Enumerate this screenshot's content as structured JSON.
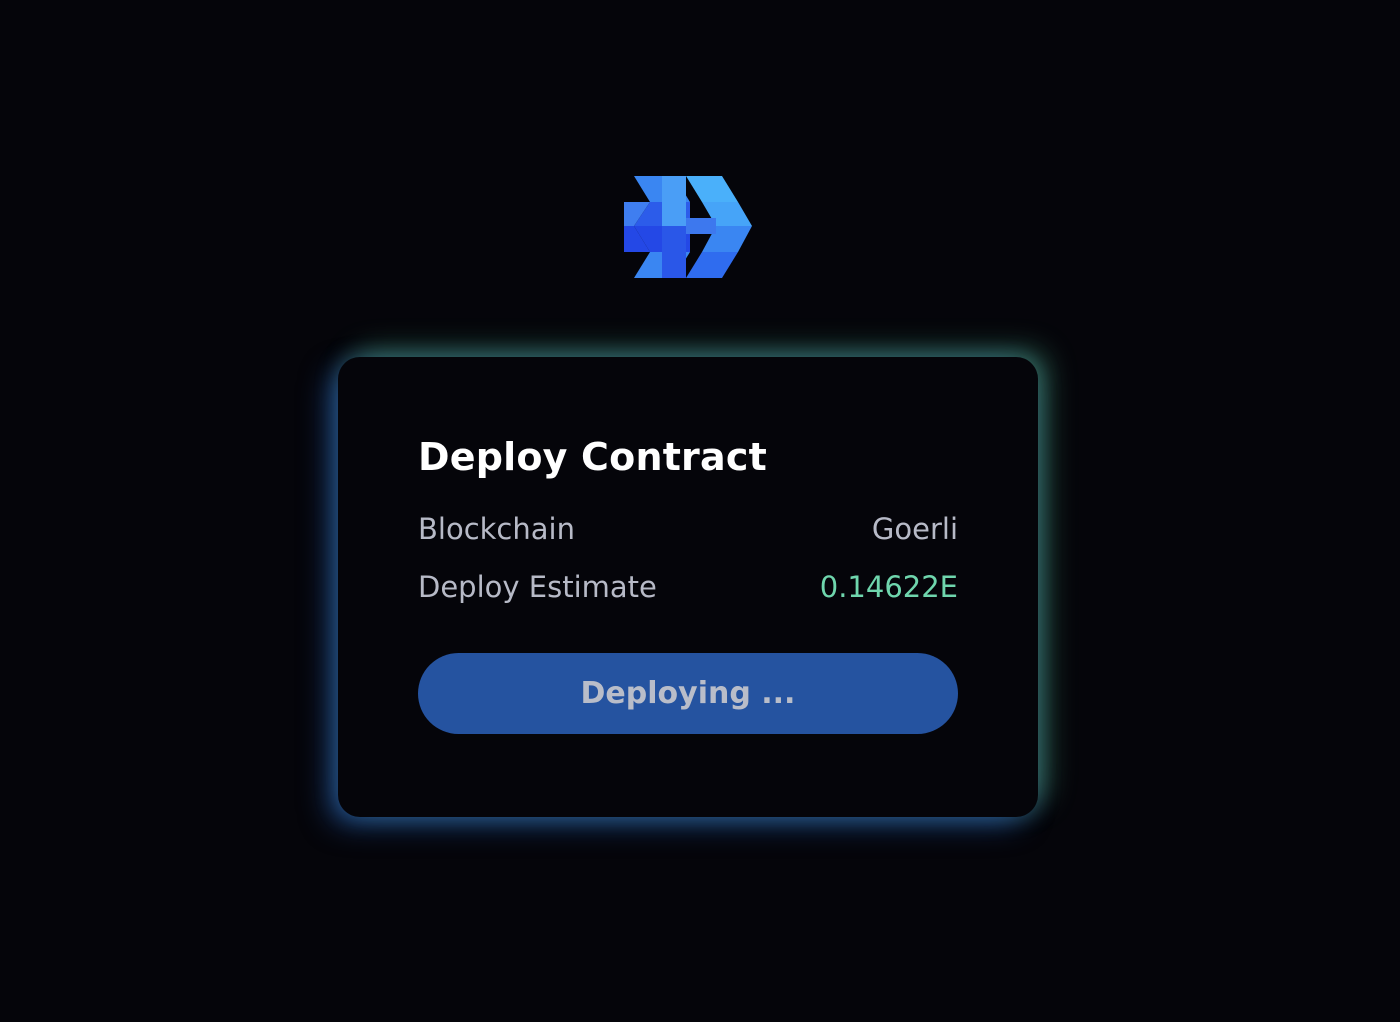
{
  "logo": {
    "icon": "h-cube-logo-icon",
    "colors": {
      "light": "#4aa8f8",
      "mid": "#3a7bf0",
      "dark": "#2448e6"
    }
  },
  "card": {
    "title": "Deploy Contract",
    "rows": [
      {
        "label": "Blockchain",
        "value": "Goerli"
      },
      {
        "label": "Deploy Estimate",
        "value": "0.14622E"
      }
    ],
    "button_label": "Deploying ..."
  },
  "colors": {
    "background": "#05050a",
    "button": "#2553a0",
    "estimate": "#6fd6ad",
    "glow_blue": "#2d6ed2",
    "glow_green": "#5fc896"
  }
}
